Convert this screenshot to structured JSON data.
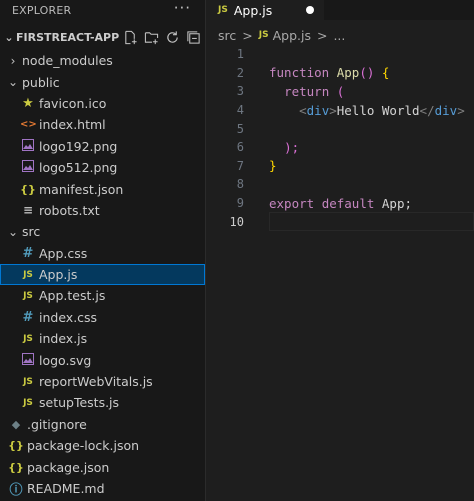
{
  "explorer": {
    "title": "EXPLORER",
    "more": "···",
    "project": "FIRSTREACT-APP",
    "items": [
      {
        "label": "node_modules",
        "kind": "folder",
        "open": false,
        "depth": 0
      },
      {
        "label": "public",
        "kind": "folder",
        "open": true,
        "depth": 0
      },
      {
        "label": "favicon.ico",
        "icon": "star-icon",
        "depth": 1
      },
      {
        "label": "index.html",
        "icon": "html-icon",
        "depth": 1
      },
      {
        "label": "logo192.png",
        "icon": "image-icon",
        "depth": 1
      },
      {
        "label": "logo512.png",
        "icon": "image-icon",
        "depth": 1
      },
      {
        "label": "manifest.json",
        "icon": "json-icon",
        "depth": 1
      },
      {
        "label": "robots.txt",
        "icon": "text-icon",
        "depth": 1
      },
      {
        "label": "src",
        "kind": "folder",
        "open": true,
        "depth": 0
      },
      {
        "label": "App.css",
        "icon": "css-icon",
        "depth": 1
      },
      {
        "label": "App.js",
        "icon": "js-icon",
        "depth": 1,
        "selected": true
      },
      {
        "label": "App.test.js",
        "icon": "test-js-icon",
        "depth": 1
      },
      {
        "label": "index.css",
        "icon": "css-icon",
        "depth": 1
      },
      {
        "label": "index.js",
        "icon": "js-icon",
        "depth": 1
      },
      {
        "label": "logo.svg",
        "icon": "image-icon",
        "depth": 1
      },
      {
        "label": "reportWebVitals.js",
        "icon": "js-icon",
        "depth": 1
      },
      {
        "label": "setupTests.js",
        "icon": "js-icon",
        "depth": 1
      },
      {
        "label": ".gitignore",
        "icon": "git-icon",
        "depth": 0
      },
      {
        "label": "package-lock.json",
        "icon": "json-icon",
        "depth": 0
      },
      {
        "label": "package.json",
        "icon": "json-icon",
        "depth": 0
      },
      {
        "label": "README.md",
        "icon": "info-icon",
        "depth": 0
      }
    ]
  },
  "tab": {
    "label": "App.js",
    "icon_text": "JS"
  },
  "breadcrumb": {
    "folder": "src",
    "sep": ">",
    "file": "App.js",
    "more": "...",
    "icon_text": "JS"
  },
  "editor": {
    "current_line": 10,
    "lines": [
      {
        "n": "1"
      },
      {
        "n": "2"
      },
      {
        "n": "3"
      },
      {
        "n": "4"
      },
      {
        "n": "5"
      },
      {
        "n": "6"
      },
      {
        "n": "7"
      },
      {
        "n": "8"
      },
      {
        "n": "9"
      },
      {
        "n": "10"
      }
    ],
    "tokens": {
      "function": "function",
      "app_name": "App",
      "parens": "()",
      "lbrace": "{",
      "return": "return",
      "lparen": "(",
      "open_tag_lt": "<",
      "div": "div",
      "open_tag_gt": ">",
      "hello": "Hello World",
      "close_tag_lt": "</",
      "close_paren_semi": ");",
      "rbrace": "}",
      "export": "export",
      "default": "default",
      "app_semi": "App;"
    }
  },
  "colors": {
    "accent": "#0078d4",
    "selected_bg": "#04395e",
    "js_yellow": "#cbcb41"
  }
}
